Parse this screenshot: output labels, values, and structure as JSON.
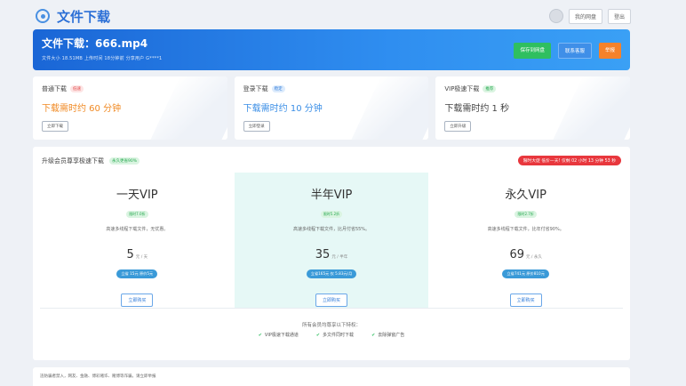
{
  "header": {
    "title": "文件下载",
    "my_drive_label": "我的网盘",
    "logout_label": "登出"
  },
  "banner": {
    "file_name": "文件下载：666.mp4",
    "meta": "文件大小 18.51MB  上传时间 18分钟前  分享用户 G****1",
    "actions": [
      "保存到网盘",
      "联系客服",
      "举报"
    ]
  },
  "options": [
    {
      "title": "普通下载",
      "tag": "低速",
      "time": "下载需时约 60 分钟",
      "button": "立即下载"
    },
    {
      "title": "登录下载",
      "tag": "稳定",
      "time": "下载需时约 10 分钟",
      "button": "立即登录"
    },
    {
      "title": "VIP极速下载",
      "tag": "推荐",
      "time": "下载需时约 1 秒",
      "button": "立即升级"
    }
  ],
  "vip": {
    "title": "升级会员尊享极速下载",
    "title_tag": "永久更省90%",
    "promo": "限时大促 低价一天! 仅剩 02 小时 13 分钟 53 秒",
    "plans": [
      {
        "name": "一天VIP",
        "tag": "限时7.0折",
        "desc": "高速多线程下载文件，无优惠。",
        "price": "5",
        "unit": "元 / 天",
        "pill": "立省 15元 原价5元",
        "buy": "立即购买"
      },
      {
        "name": "半年VIP",
        "tag": "限时5.2折",
        "desc": "高速多线程下载文件，比月付省55%。",
        "price": "35",
        "unit": "元 / 半年",
        "pill": "立省165元 仅 5.83元/月",
        "buy": "立即购买"
      },
      {
        "name": "永久VIP",
        "tag": "限时2.7折",
        "desc": "高速多线程下载文件，比年付省90%。",
        "price": "69",
        "unit": "元 / 永久",
        "pill": "立省741元 原价810元",
        "buy": "立即购买"
      }
    ],
    "perks_title": "所有会员均尊享以下特权：",
    "perks": [
      "VIP极速下载通道",
      "多文件同时下载",
      "去除弹窗广告"
    ]
  },
  "footer": {
    "text": "违防骗者禁入，网友、金融、博彩赌诈、赌博等诈骗，请立即举报"
  }
}
